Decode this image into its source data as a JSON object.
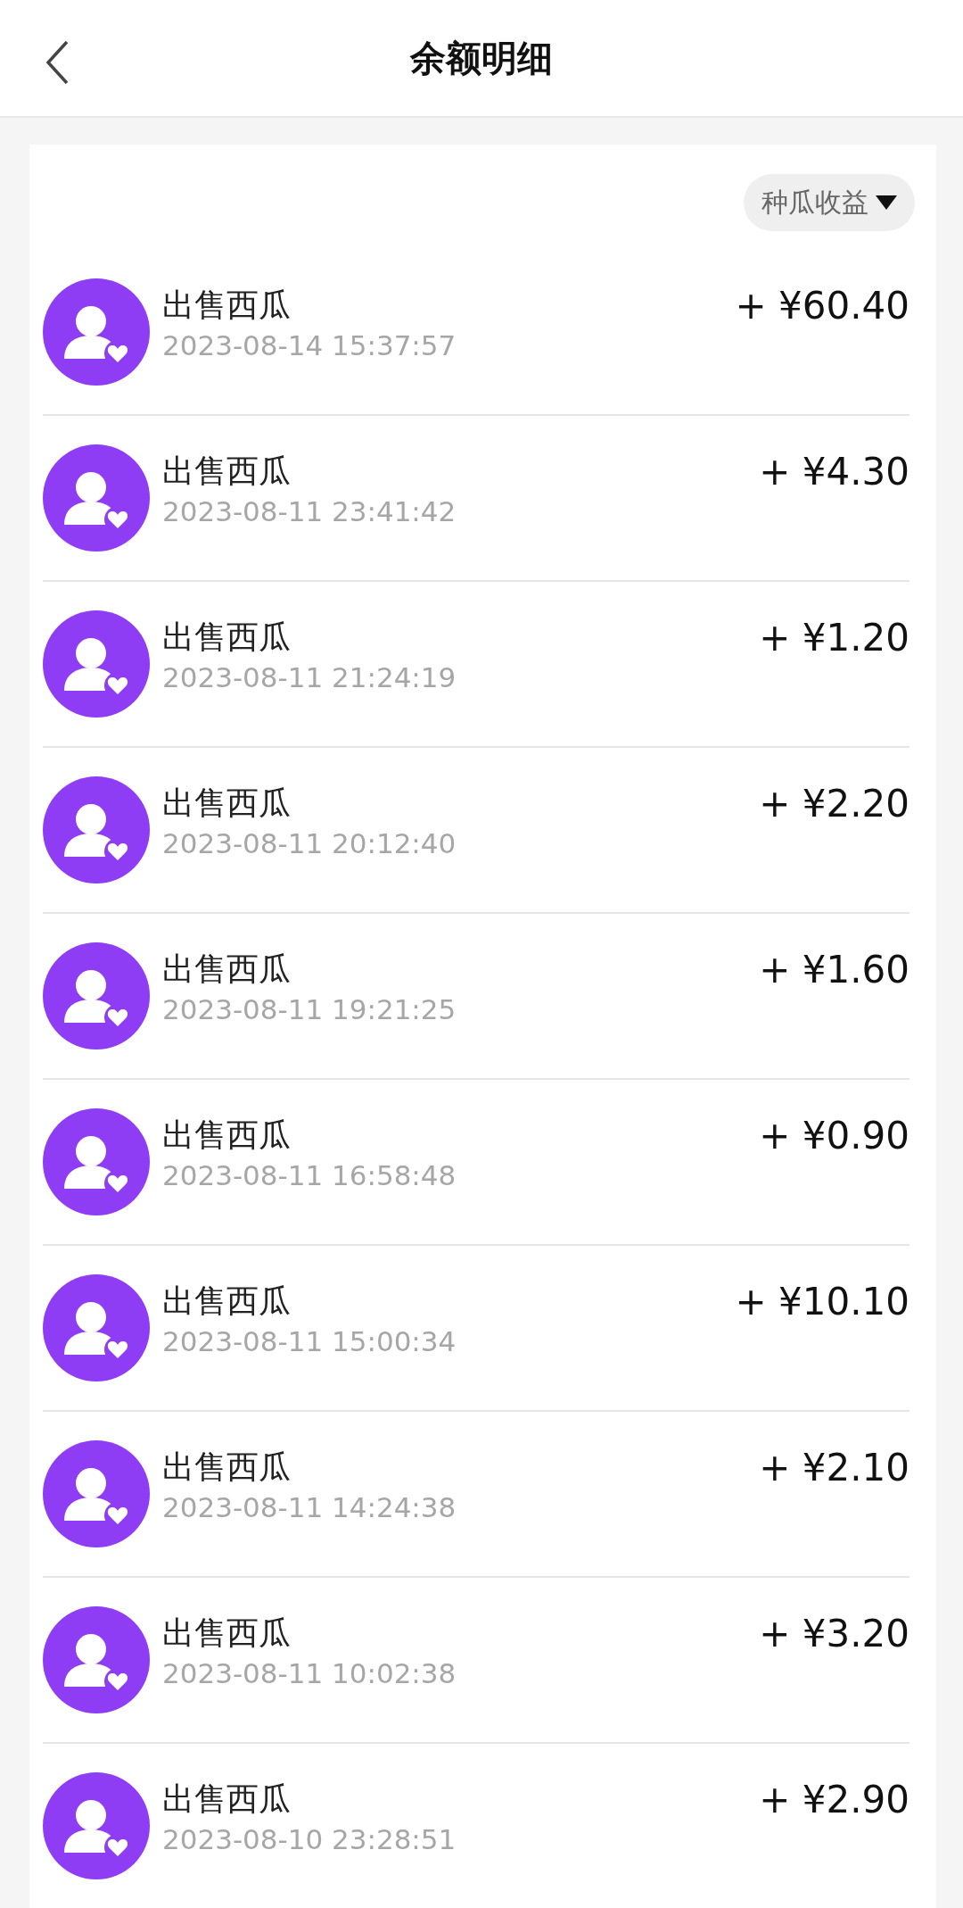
{
  "header": {
    "title": "余额明细"
  },
  "filter": {
    "label": "种瓜收益"
  },
  "transactions": [
    {
      "title": "出售西瓜",
      "time": "2023-08-14 15:37:57",
      "amount": "+ ¥60.40"
    },
    {
      "title": "出售西瓜",
      "time": "2023-08-11 23:41:42",
      "amount": "+ ¥4.30"
    },
    {
      "title": "出售西瓜",
      "time": "2023-08-11 21:24:19",
      "amount": "+ ¥1.20"
    },
    {
      "title": "出售西瓜",
      "time": "2023-08-11 20:12:40",
      "amount": "+ ¥2.20"
    },
    {
      "title": "出售西瓜",
      "time": "2023-08-11 19:21:25",
      "amount": "+ ¥1.60"
    },
    {
      "title": "出售西瓜",
      "time": "2023-08-11 16:58:48",
      "amount": "+ ¥0.90"
    },
    {
      "title": "出售西瓜",
      "time": "2023-08-11 15:00:34",
      "amount": "+ ¥10.10"
    },
    {
      "title": "出售西瓜",
      "time": "2023-08-11 14:24:38",
      "amount": "+ ¥2.10"
    },
    {
      "title": "出售西瓜",
      "time": "2023-08-11 10:02:38",
      "amount": "+ ¥3.20"
    },
    {
      "title": "出售西瓜",
      "time": "2023-08-10 23:28:51",
      "amount": "+ ¥2.90"
    }
  ]
}
